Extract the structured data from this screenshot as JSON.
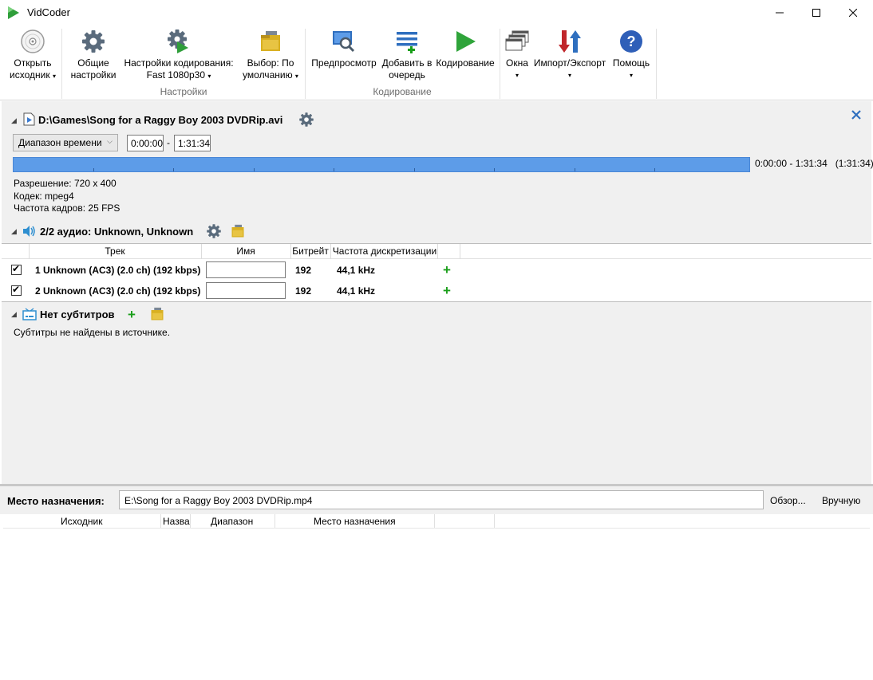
{
  "window": {
    "title": "VidCoder",
    "minimize_glyph": "─",
    "close_glyph": "✕"
  },
  "ribbon": {
    "open_source": {
      "line1": "Открыть",
      "line2": "исходник",
      "arrow": "▾"
    },
    "general_settings": {
      "line1": "Общие",
      "line2": "настройки"
    },
    "encoding_settings": {
      "line1": "Настройки кодирования:",
      "line2": "Fast 1080p30",
      "arrow": "▾"
    },
    "default_choice": {
      "line1": "Выбор: По",
      "line2": "умолчанию",
      "arrow": "▾"
    },
    "preview": {
      "line1": "Предпросмотр"
    },
    "add_queue": {
      "line1": "Добавить в",
      "line2": "очередь"
    },
    "encode": {
      "line1": "Кодирование"
    },
    "windows": {
      "line1": "Окна",
      "arrow": "▾"
    },
    "import_export": {
      "line1": "Импорт/Экспорт",
      "arrow": "▾"
    },
    "help": {
      "line1": "Помощь",
      "arrow": "▾"
    },
    "group_settings": "Настройки",
    "group_encoding": "Кодирование"
  },
  "source": {
    "path": "D:\\Games\\Song for a Raggy Boy 2003 DVDRip.avi",
    "range_type": "Диапазон времени",
    "start": "0:00:00",
    "dash": "-",
    "end": "1:31:34",
    "range_text": "0:00:00 - 1:31:34",
    "duration_text": "(1:31:34)",
    "resolution": "Разрешение: 720 x 400",
    "codec": "Кодек: mpeg4",
    "framerate": "Частота кадров: 25  FPS"
  },
  "audio": {
    "title": "2/2 аудио: Unknown, Unknown",
    "columns": {
      "track": "Трек",
      "name": "Имя",
      "bitrate": "Битрейт",
      "samplerate": "Частота дискретизации"
    },
    "rows": [
      {
        "track": "1 Unknown (AC3) (2.0 ch) (192 kbps)",
        "name": "",
        "bitrate": "192",
        "samplerate": "44,1 kHz",
        "checked": true
      },
      {
        "track": "2 Unknown (AC3) (2.0 ch) (192 kbps)",
        "name": "",
        "bitrate": "192",
        "samplerate": "44,1 kHz",
        "checked": true
      }
    ],
    "add_glyph": "+"
  },
  "subtitles": {
    "title": "Нет субтитров",
    "message": "Субтитры не найдены в источнике.",
    "add_glyph": "+"
  },
  "destination": {
    "label": "Место назначения:",
    "path": "E:\\Song for a Raggy Boy 2003 DVDRip.mp4",
    "browse": "Обзор...",
    "manual": "Вручную"
  },
  "queue": {
    "columns": {
      "source": "Исходник",
      "name": "Назва",
      "range": "Диапазон",
      "destination": "Место назначения"
    }
  },
  "icons": {
    "collapse": "◢",
    "chevron": "⌵",
    "check": "✔"
  },
  "colors": {
    "accent_blue": "#5d9ce8",
    "green": "#1a9e1a",
    "red": "#d42b2b",
    "gear": "#5a6b7c",
    "folder": "#d9b021"
  }
}
